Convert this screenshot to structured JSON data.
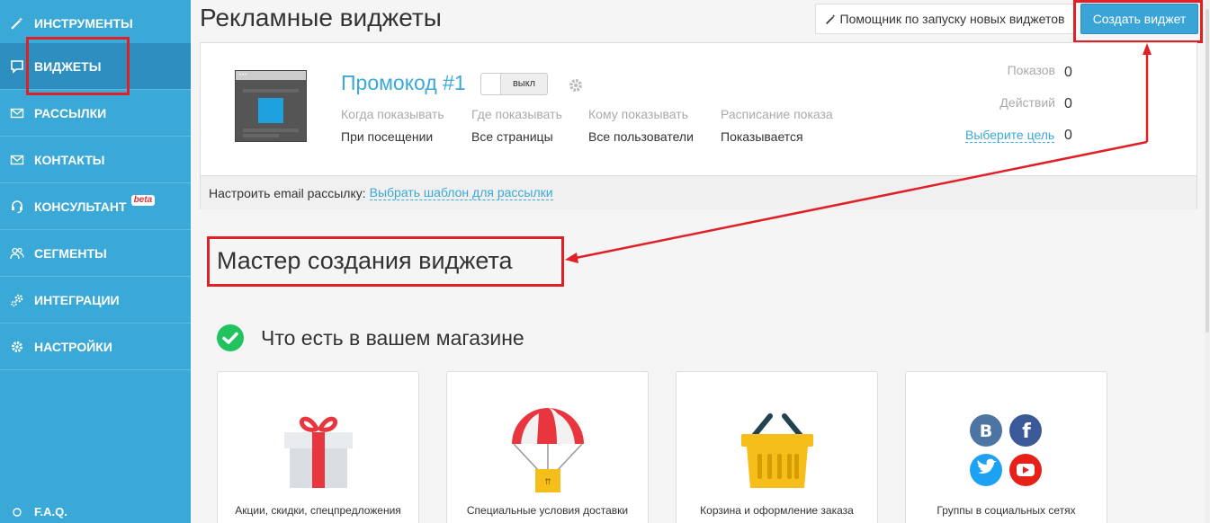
{
  "sidebar": {
    "items": [
      {
        "label": "ИНСТРУМЕНТЫ",
        "icon": "magic-wand-icon"
      },
      {
        "label": "ВИДЖЕТЫ",
        "icon": "chat-bubble-icon",
        "active": true
      },
      {
        "label": "РАССЫЛКИ",
        "icon": "envelope-icon"
      },
      {
        "label": "КОНТАКТЫ",
        "icon": "envelope-icon"
      },
      {
        "label": "КОНСУЛЬТАНТ",
        "icon": "headset-icon",
        "badge": "beta"
      },
      {
        "label": "СЕГМЕНТЫ",
        "icon": "users-icon"
      },
      {
        "label": "ИНТЕГРАЦИИ",
        "icon": "gears-icon"
      },
      {
        "label": "НАСТРОЙКИ",
        "icon": "gear-icon"
      }
    ],
    "faq": "F.A.Q."
  },
  "header": {
    "title": "Рекламные виджеты",
    "helper_button": "Помощник по запуску новых виджетов",
    "create_button": "Создать виджет"
  },
  "widget": {
    "name": "Промокод #1",
    "toggle": "выкл",
    "columns": [
      {
        "label": "Когда показывать",
        "value": "При посещении"
      },
      {
        "label": "Где показывать",
        "value": "Все страницы"
      },
      {
        "label": "Кому показывать",
        "value": "Все пользователи"
      },
      {
        "label": "Расписание показа",
        "value": "Показывается"
      }
    ],
    "stats": {
      "views_label": "Показов",
      "views_value": "0",
      "actions_label": "Действий",
      "actions_value": "0",
      "goal_link": "Выберите цель",
      "goal_value": "0"
    },
    "footer_text": "Настроить email рассылку:",
    "footer_link": "Выбрать шаблон для рассылки"
  },
  "wizard": {
    "title": "Мастер создания виджета",
    "section_title": "Что есть в вашем магазине",
    "tiles": [
      {
        "label": "Акции, скидки, спецпредложения",
        "icon": "gift-icon"
      },
      {
        "label": "Специальные условия доставки",
        "icon": "parachute-box-icon"
      },
      {
        "label": "Корзина и оформление заказа",
        "icon": "basket-icon"
      },
      {
        "label": "Группы в социальных сетях",
        "icon": "social-networks-icon"
      }
    ]
  },
  "colors": {
    "sidebar": "#3aa9d8",
    "accent": "#3ba4d6",
    "annotation": "#e01f26"
  }
}
